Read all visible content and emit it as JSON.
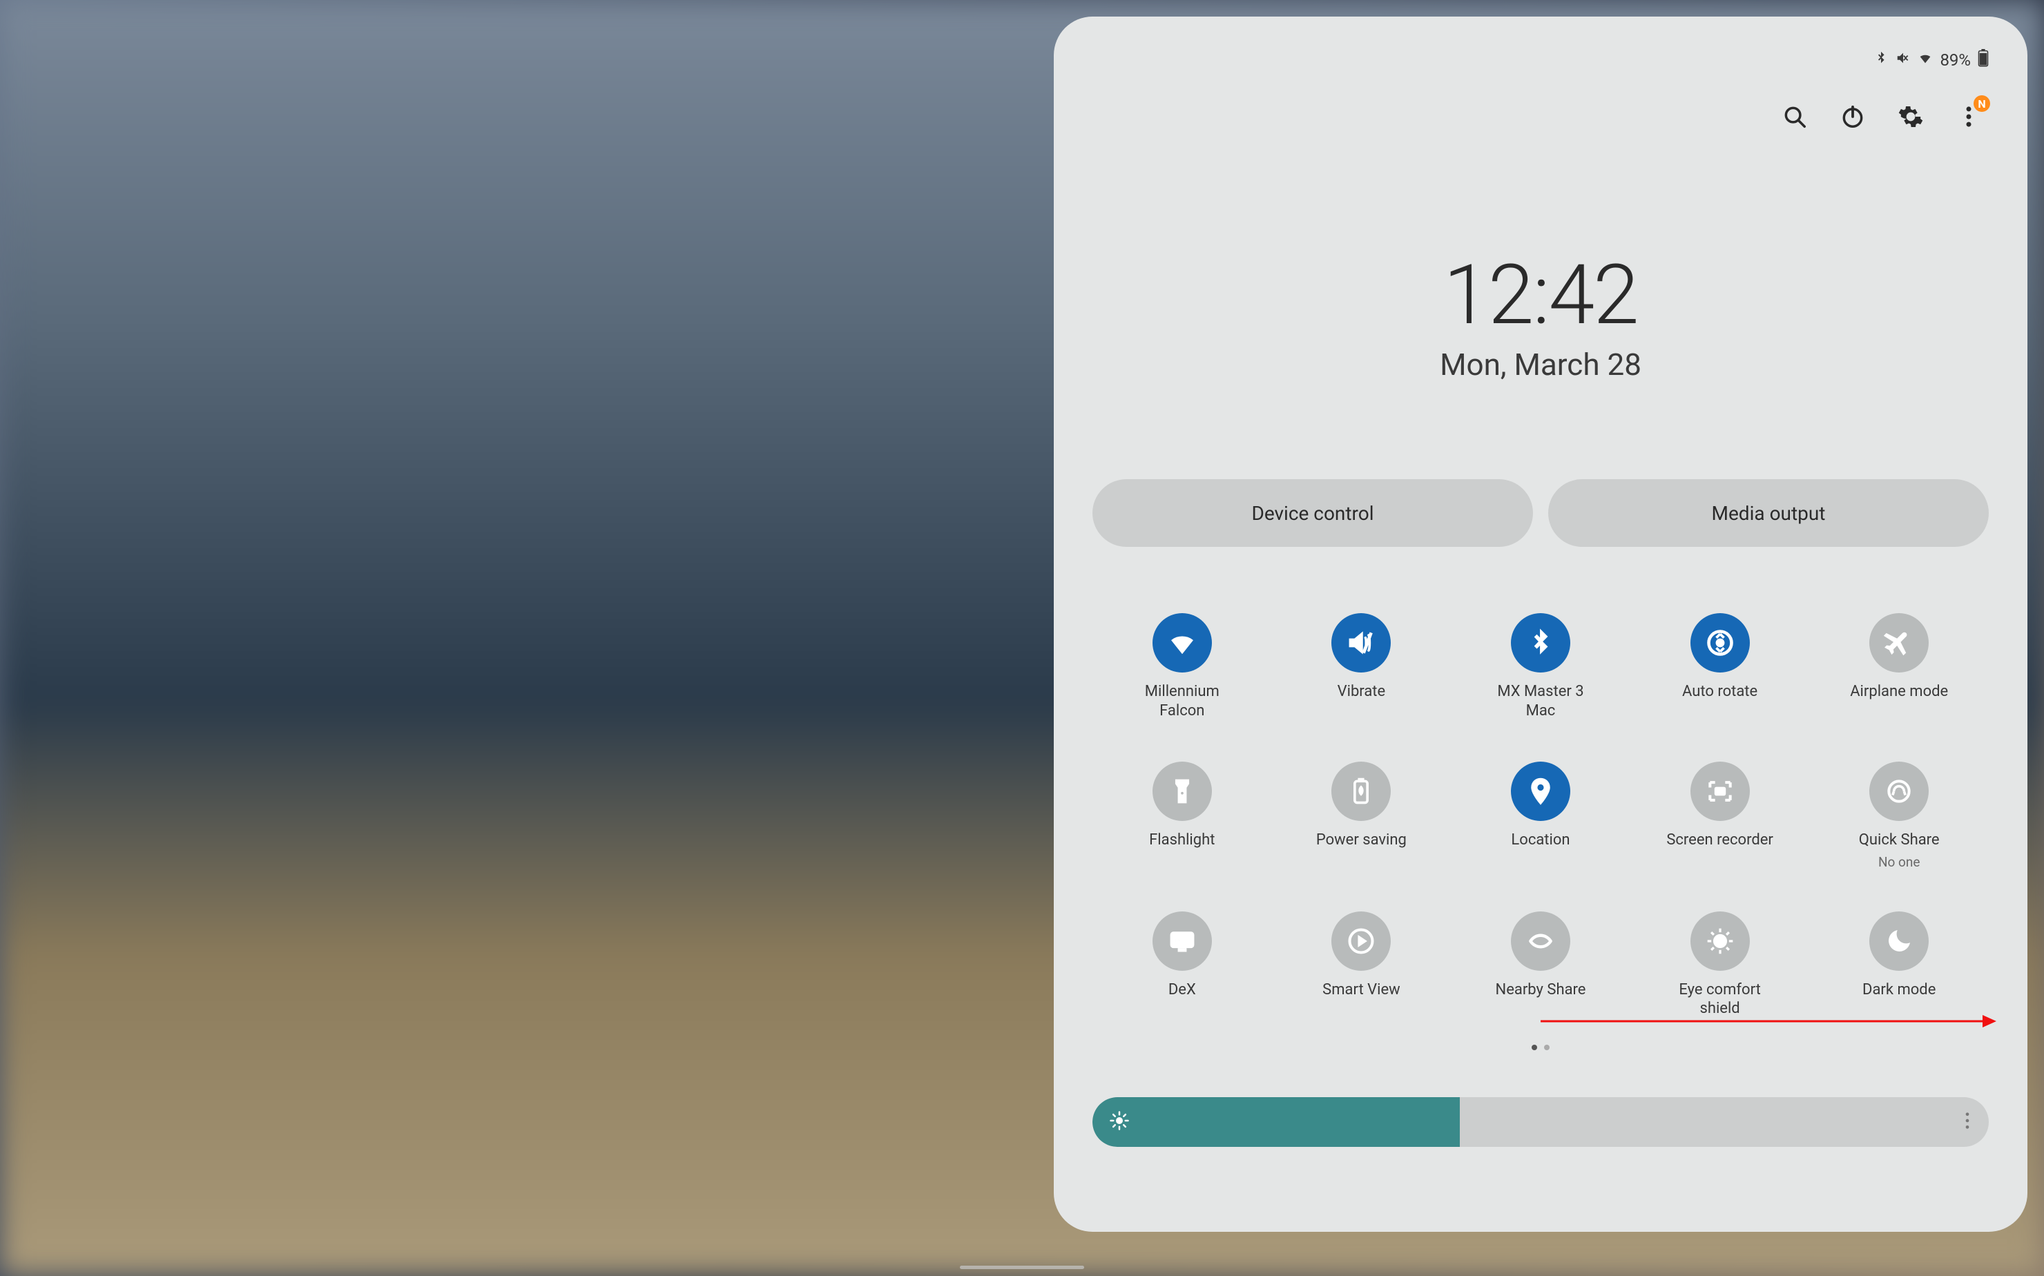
{
  "status": {
    "battery_pct": "89%"
  },
  "toprow": {
    "badge_letter": "N"
  },
  "clock": {
    "time": "12:42",
    "date": "Mon, March 28"
  },
  "pills": {
    "device_control": "Device control",
    "media_output": "Media output"
  },
  "tiles": [
    {
      "label": "Millennium Falcon",
      "sub": "",
      "on": true,
      "icon": "wifi"
    },
    {
      "label": "Vibrate",
      "sub": "",
      "on": true,
      "icon": "vibrate"
    },
    {
      "label": "MX Master 3 Mac",
      "sub": "",
      "on": true,
      "icon": "bluetooth"
    },
    {
      "label": "Auto rotate",
      "sub": "",
      "on": true,
      "icon": "rotate"
    },
    {
      "label": "Airplane mode",
      "sub": "",
      "on": false,
      "icon": "airplane"
    },
    {
      "label": "Flashlight",
      "sub": "",
      "on": false,
      "icon": "flashlight"
    },
    {
      "label": "Power saving",
      "sub": "",
      "on": false,
      "icon": "power-saving"
    },
    {
      "label": "Location",
      "sub": "",
      "on": true,
      "icon": "location"
    },
    {
      "label": "Screen recorder",
      "sub": "",
      "on": false,
      "icon": "screen-recorder"
    },
    {
      "label": "Quick Share",
      "sub": "No one",
      "on": false,
      "icon": "quick-share"
    },
    {
      "label": "DeX",
      "sub": "",
      "on": false,
      "icon": "dex"
    },
    {
      "label": "Smart View",
      "sub": "",
      "on": false,
      "icon": "smart-view"
    },
    {
      "label": "Nearby Share",
      "sub": "",
      "on": false,
      "icon": "nearby-share"
    },
    {
      "label": "Eye comfort shield",
      "sub": "",
      "on": false,
      "icon": "eye-comfort"
    },
    {
      "label": "Dark mode",
      "sub": "",
      "on": false,
      "icon": "dark-mode"
    }
  ],
  "brightness": {
    "percent": 41
  },
  "colors": {
    "accent_on": "#1668b5",
    "brightness_fill": "#3a8a8a",
    "badge": "#ff8c1a"
  },
  "annotation": {
    "arrow_color": "#f01010"
  }
}
